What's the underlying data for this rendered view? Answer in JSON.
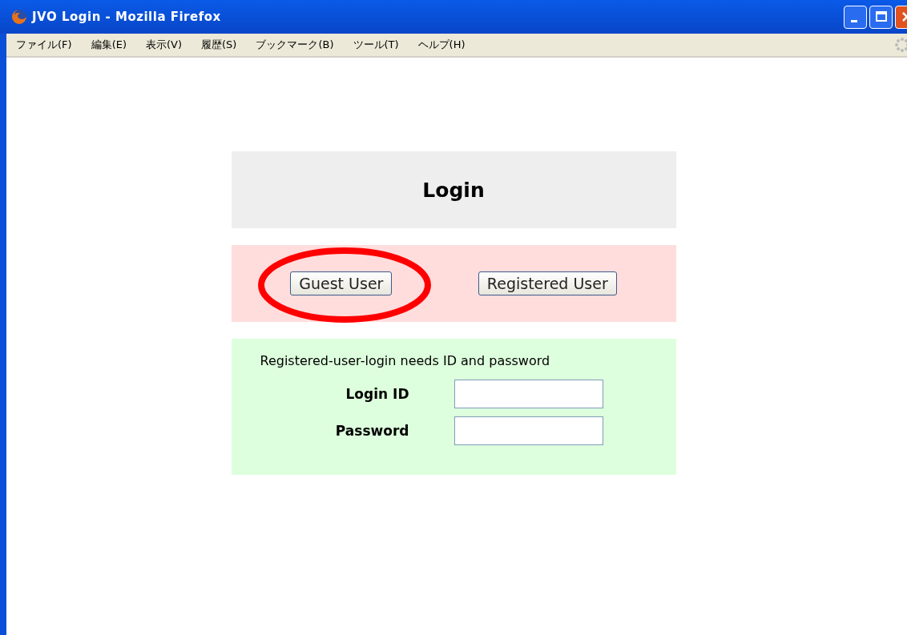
{
  "window": {
    "title": "JVO Login - Mozilla Firefox"
  },
  "menu": [
    {
      "label": "ファイル(F)"
    },
    {
      "label": "編集(E)"
    },
    {
      "label": "表示(V)"
    },
    {
      "label": "履歴(S)"
    },
    {
      "label": "ブックマーク(B)"
    },
    {
      "label": "ツール(T)"
    },
    {
      "label": "ヘルプ(H)"
    }
  ],
  "login": {
    "title": "Login",
    "buttons": [
      {
        "label": "Guest User",
        "highlighted": true
      },
      {
        "label": "Registered User",
        "highlighted": false
      }
    ],
    "note": "Registered-user-login needs ID and password",
    "fields": [
      {
        "label": "Login ID"
      },
      {
        "label": "Password"
      }
    ]
  }
}
